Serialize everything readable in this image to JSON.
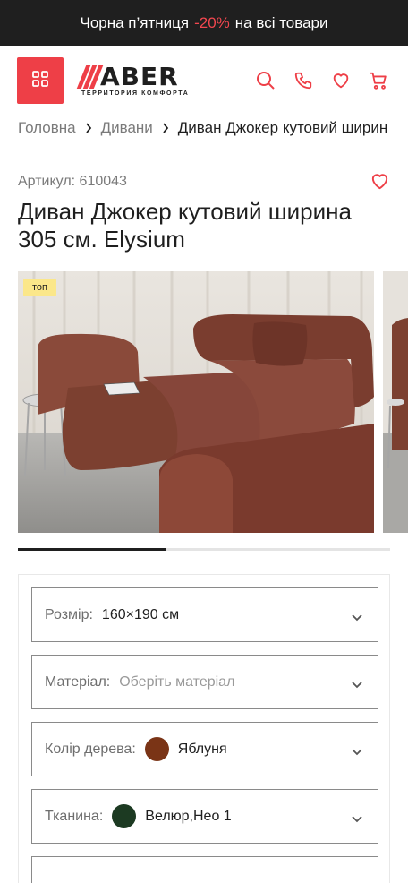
{
  "promo": {
    "prefix": "Чорна п’ятниця",
    "discount": "-20%",
    "suffix": "на всі товари"
  },
  "header": {
    "logo_word": "ABER",
    "logo_tagline": "ТЕРРИТОРИЯ КОМФОРТА",
    "icons": [
      "menu-grid-icon",
      "search-icon",
      "phone-icon",
      "heart-icon",
      "cart-icon"
    ]
  },
  "breadcrumb": {
    "items": [
      "Головна",
      "Дивани"
    ],
    "current": "Диван Джокер кутовий ширин"
  },
  "product": {
    "sku": "Артикул: 610043",
    "title": "Диван Джокер кутовий ширина 305 см. Elysium",
    "badge": "топ"
  },
  "gallery": {
    "progress": 0.4
  },
  "options": [
    {
      "label": "Розмір:",
      "value": "160×190 см",
      "placeholder": false
    },
    {
      "label": "Матеріал:",
      "value": "Оберіть матеріал",
      "placeholder": true
    },
    {
      "label": "Колір дерева:",
      "value": "Яблуня",
      "swatch": "#7a3416"
    },
    {
      "label": "Тканина:",
      "value": "Велюр,Нео 1",
      "swatch": "#1c3a22"
    }
  ],
  "colors": {
    "accent": "#ee3f47",
    "promo_bg": "#1f1f1f",
    "badge_bg": "#fbe78a",
    "text": "#1f1f1f",
    "muted": "#7a7a7a"
  }
}
